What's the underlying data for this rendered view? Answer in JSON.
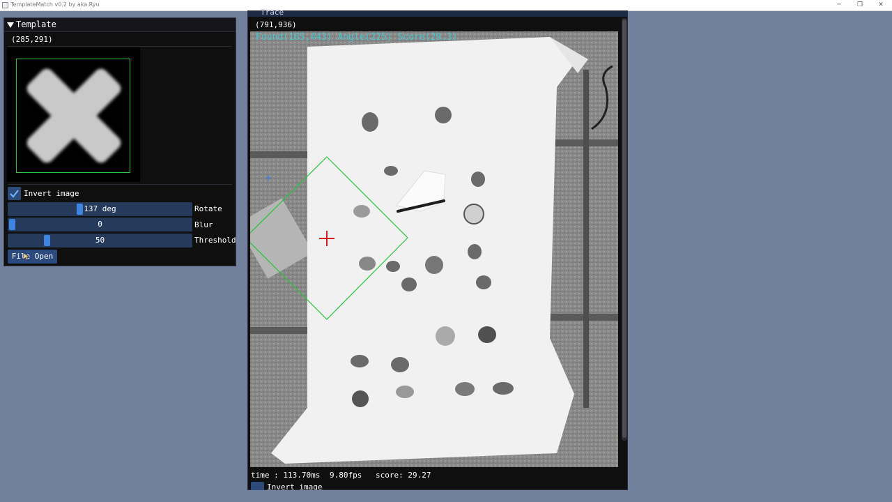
{
  "window": {
    "title": "TemplateMatch v0.2 by aka.Ryu",
    "min_glyph": "─",
    "restore_glyph": "❐",
    "close_glyph": "✕"
  },
  "template_panel": {
    "title": "Template",
    "coords": "(285,291)",
    "invert_label": "Invert image",
    "invert_checked": true,
    "rotate": {
      "value": "137 deg",
      "label": "Rotate",
      "fraction": 0.38
    },
    "blur": {
      "value": "0",
      "label": "Blur",
      "fraction": 0.0
    },
    "threshold": {
      "value": "50",
      "label": "Threshold",
      "fraction": 0.2
    },
    "file_open_label": "File Open"
  },
  "trace_panel": {
    "title": "Trace",
    "coords": "(791,936)",
    "overlay": "Found(165,443) Angle(225) Score(29.3)",
    "status": {
      "time": "time : 113.70ms",
      "fps": "9.80fps",
      "score": "score: 29.27"
    },
    "invert_label": "Invert image"
  },
  "colors": {
    "background": "#71809c",
    "panel": "#0f0f0f",
    "accent": "#3d85e0",
    "detection_box": "#26c63a",
    "crosshair": "#d42020",
    "overlay_text": "#45c6cf"
  }
}
